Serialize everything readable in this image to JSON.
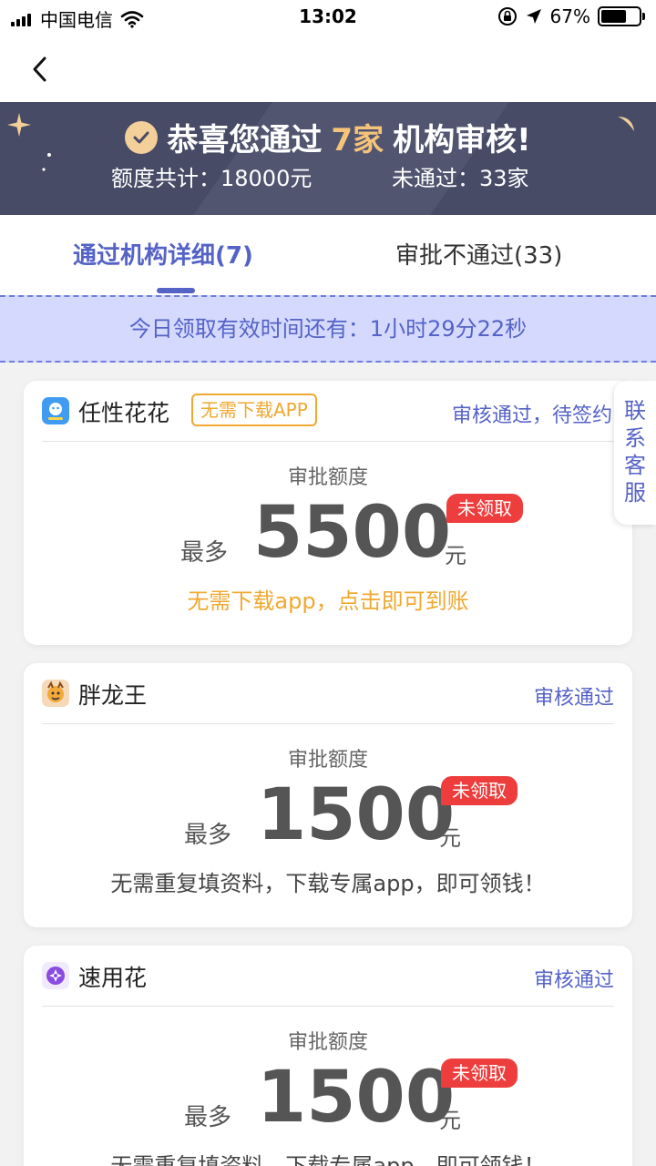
{
  "status_bar": {
    "carrier": "中国电信",
    "time": "13:02",
    "battery_percent": "67%",
    "battery_level": 0.67
  },
  "banner": {
    "title_prefix": "恭喜您通过",
    "title_highlight": "7家",
    "title_suffix": "机构审核!",
    "total_quota": "额度共计：18000元",
    "not_passed": "未通过：33家",
    "colors": {
      "background": "#474b66",
      "highlight": "#f5c37a"
    }
  },
  "tabs": [
    {
      "label": "通过机构详细(7)",
      "active": true
    },
    {
      "label": "审批不通过(33)",
      "active": false
    }
  ],
  "timer_text": "今日领取有效时间还有：1小时29分22秒",
  "service": {
    "label": "联系客服"
  },
  "cards": [
    {
      "name": "任性花花",
      "tag": "无需下载APP",
      "status": "审核通过，待签约",
      "label": "审批额度",
      "prefix": "最多",
      "amount": "5500",
      "unit": "元",
      "badge": "未领取",
      "desc": "无需下载app，点击即可到账",
      "desc_color": "#f0a830",
      "logo_icon": "hippo-icon"
    },
    {
      "name": "胖龙王",
      "status": "审核通过",
      "label": "审批额度",
      "prefix": "最多",
      "amount": "1500",
      "unit": "元",
      "badge": "未领取",
      "desc": "无需重复填资料，下载专属app，即可领钱！",
      "desc_color": "#444444",
      "logo_icon": "dragon-icon"
    },
    {
      "name": "速用花",
      "status": "审核通过",
      "label": "审批额度",
      "prefix": "最多",
      "amount": "1500",
      "unit": "元",
      "badge": "未领取",
      "desc": "无需重复填资料，下载专属app，即可领钱！",
      "desc_color": "#444444",
      "logo_icon": "flower-icon"
    }
  ],
  "colors": {
    "accent": "#5563c7",
    "badge": "#ee3d3d",
    "tag": "#f0a830"
  }
}
